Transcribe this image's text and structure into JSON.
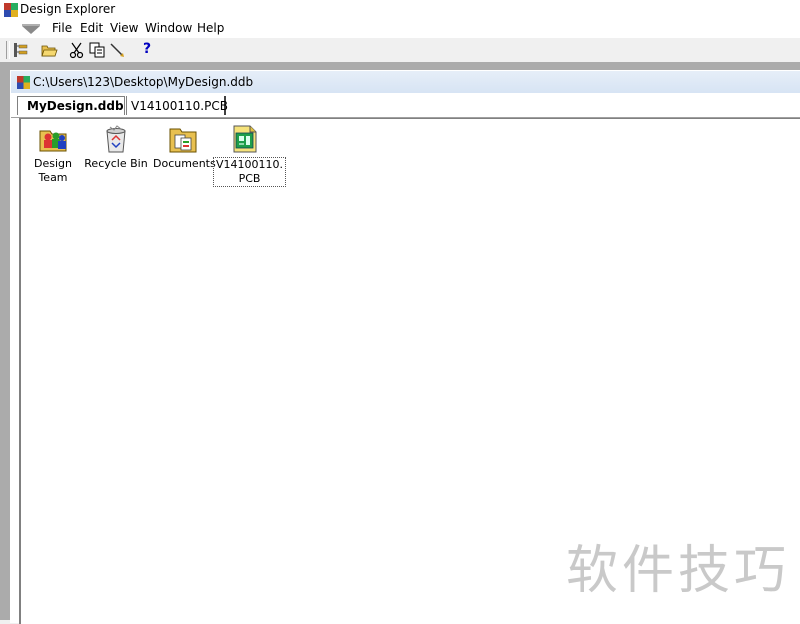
{
  "window": {
    "title": "Design Explorer"
  },
  "menu": {
    "items": [
      "File",
      "Edit",
      "View",
      "Window",
      "Help"
    ]
  },
  "toolbar": {
    "help_label": "?"
  },
  "document": {
    "path": "C:\\Users\\123\\Desktop\\MyDesign.ddb",
    "tabs": [
      {
        "label": "MyDesign.ddb",
        "active": true
      },
      {
        "label": "V14100110.PCB",
        "active": false
      }
    ],
    "items": [
      {
        "label_line1": "Design",
        "label_line2": "Team",
        "icon": "design-team-icon"
      },
      {
        "label_line1": "Recycle Bin",
        "label_line2": "",
        "icon": "recycle-bin-icon"
      },
      {
        "label_line1": "Documents",
        "label_line2": "",
        "icon": "documents-folder-icon"
      },
      {
        "label_line1": "V14100110.",
        "label_line2": "PCB",
        "icon": "pcb-document-icon",
        "selected": true
      }
    ]
  },
  "watermark": "软件技巧"
}
